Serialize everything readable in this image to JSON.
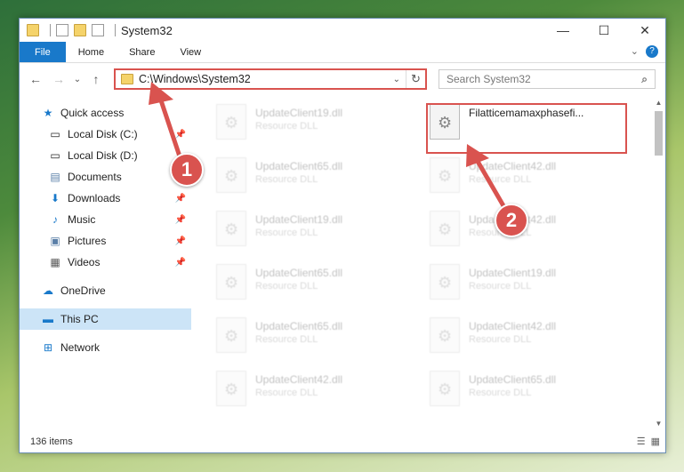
{
  "window": {
    "title": "System32",
    "controls": {
      "minimize": "—",
      "maximize": "☐",
      "close": "✕"
    }
  },
  "ribbon": {
    "tabs": [
      "File",
      "Home",
      "Share",
      "View"
    ],
    "expand_glyph": "⌄",
    "help_glyph": "?"
  },
  "navbar": {
    "back": "←",
    "forward": "→",
    "recent": "⌄",
    "up": "↑",
    "address": "C:\\Windows\\System32",
    "address_chevron": "⌄",
    "refresh": "↻",
    "search_placeholder": "Search System32",
    "search_glyph": "⌕"
  },
  "sidebar": {
    "items": [
      {
        "label": "Quick access",
        "icon": "star-icon",
        "glyph": "★"
      },
      {
        "label": "Local Disk (C:)",
        "icon": "drive-icon",
        "glyph": "▭",
        "pinned": true
      },
      {
        "label": "Local Disk (D:)",
        "icon": "drive-icon",
        "glyph": "▭"
      },
      {
        "label": "Documents",
        "icon": "document-icon",
        "glyph": "▤"
      },
      {
        "label": "Downloads",
        "icon": "download-icon",
        "glyph": "⬇",
        "pinned": true
      },
      {
        "label": "Music",
        "icon": "music-icon",
        "glyph": "♪",
        "pinned": true
      },
      {
        "label": "Pictures",
        "icon": "picture-icon",
        "glyph": "▣",
        "pinned": true
      },
      {
        "label": "Videos",
        "icon": "video-icon",
        "glyph": "▦",
        "pinned": true
      },
      {
        "label": "OneDrive",
        "icon": "cloud-icon",
        "glyph": "☁"
      },
      {
        "label": "This PC",
        "icon": "computer-icon",
        "glyph": "▬",
        "selected": true
      },
      {
        "label": "Network",
        "icon": "network-icon",
        "glyph": "⊞"
      }
    ],
    "pin_glyph": "📌"
  },
  "files": {
    "left_column": [
      {
        "name": "UpdateClient19.dll",
        "type": "Resource DLL"
      },
      {
        "name": "UpdateClient65.dll",
        "type": "Resource DLL"
      },
      {
        "name": "UpdateClient19.dll",
        "type": "Resource DLL"
      },
      {
        "name": "UpdateClient65.dll",
        "type": "Resource DLL"
      },
      {
        "name": "UpdateClient65.dll",
        "type": "Resource DLL"
      },
      {
        "name": "UpdateClient42.dll",
        "type": "Resource DLL"
      }
    ],
    "right_column": [
      {
        "name": "Filatticemamaxphasefi...",
        "type": ""
      },
      {
        "name": "UpdateClient42.dll",
        "type": "Resource DLL"
      },
      {
        "name": "UpdateClient42.dll",
        "type": "Resource DLL"
      },
      {
        "name": "UpdateClient19.dll",
        "type": "Resource DLL"
      },
      {
        "name": "UpdateClient42.dll",
        "type": "Resource DLL"
      },
      {
        "name": "UpdateClient65.dll",
        "type": "Resource DLL"
      }
    ]
  },
  "status": {
    "item_count": "136 items",
    "details_view_glyph": "☰",
    "tiles_view_glyph": "▦"
  },
  "annotations": {
    "step1": "1",
    "step2": "2",
    "color": "#d9534f"
  }
}
